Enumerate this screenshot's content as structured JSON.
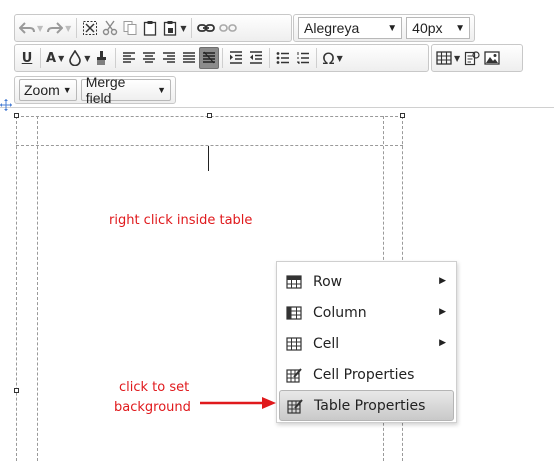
{
  "toolbar": {
    "row1": {
      "undo_icon": "undo-arrow-icon",
      "redo_icon": "redo-arrow-icon",
      "select_all_icon": "select-all-icon",
      "cut_icon": "scissors-icon",
      "copy_icon": "copy-icon",
      "paste_icon": "clipboard-icon",
      "paste_special_icon": "clipboard-options-icon",
      "link_icon": "chain-link-icon",
      "unlink_icon": "broken-link-icon",
      "font_family": "Alegreya",
      "font_size": "40px"
    },
    "row2": {
      "underline_label": "U",
      "text_color_label": "A",
      "bg_color_icon": "droplet-icon",
      "clear_format_icon": "paint-brush-icon",
      "align_icons": [
        "align-left-icon",
        "align-center-icon",
        "align-right-icon",
        "align-justify-icon",
        "align-none-icon"
      ],
      "indent_icons": [
        "indent-icon",
        "outdent-icon"
      ],
      "list_icons": [
        "bullet-list-icon",
        "numbered-list-icon"
      ],
      "omega_label": "Ω",
      "table_icon": "table-icon",
      "template_icon": "template-icon",
      "image_icon": "image-icon"
    },
    "row3": {
      "zoom_label": "Zoom",
      "merge_field_label": "Merge field"
    }
  },
  "editor": {
    "instruction": "right click inside table",
    "callout_line1": "click to set",
    "callout_line2": "background",
    "annotation_color": "#e0191c"
  },
  "context_menu": {
    "items": [
      {
        "label": "Row",
        "icon": "table-row-icon",
        "submenu": true
      },
      {
        "label": "Column",
        "icon": "table-column-icon",
        "submenu": true
      },
      {
        "label": "Cell",
        "icon": "table-cell-icon",
        "submenu": true
      },
      {
        "label": "Cell Properties",
        "icon": "cell-properties-icon",
        "submenu": false
      },
      {
        "label": "Table Properties",
        "icon": "table-properties-icon",
        "submenu": false,
        "highlighted": true
      }
    ]
  }
}
